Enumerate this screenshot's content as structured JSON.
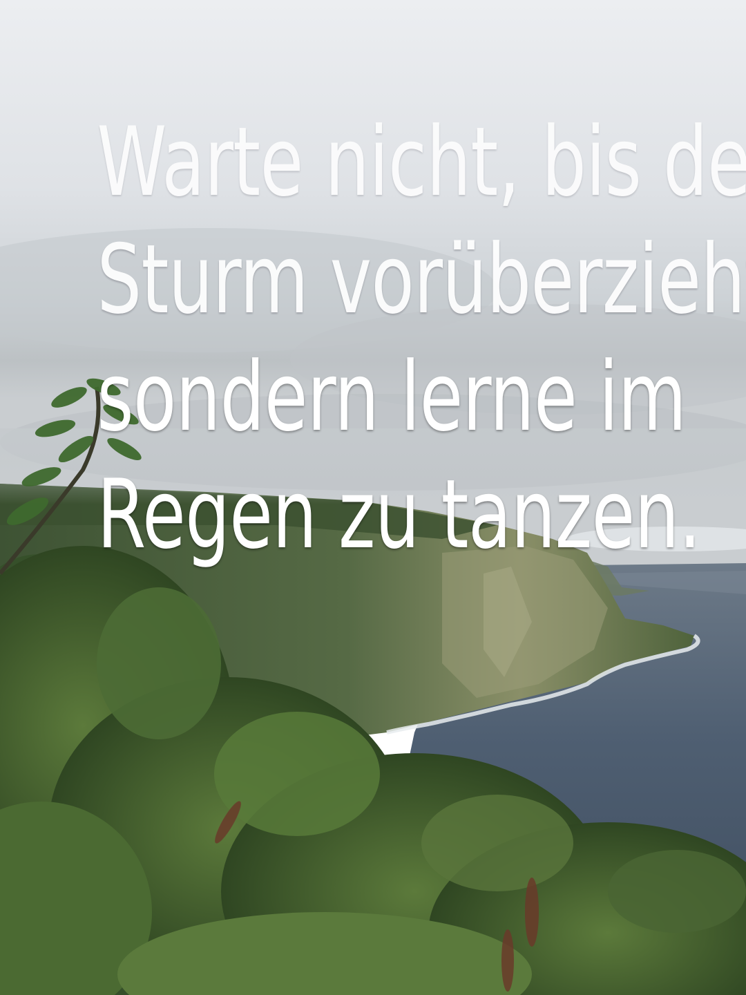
{
  "quote": {
    "lines": [
      "Warte nicht, bis der",
      "Sturm vorüberzieht,",
      "sondern lerne im",
      "Regen zu tanzen."
    ]
  },
  "colors": {
    "sky_top": "#e6e8ec",
    "sky_mid": "#d3d7db",
    "sky_low": "#b7bcc0",
    "ocean": "#4f5f72",
    "cliff": "#5d6e4a",
    "foliage": "#3f5a2c",
    "text": "#ffffff"
  }
}
